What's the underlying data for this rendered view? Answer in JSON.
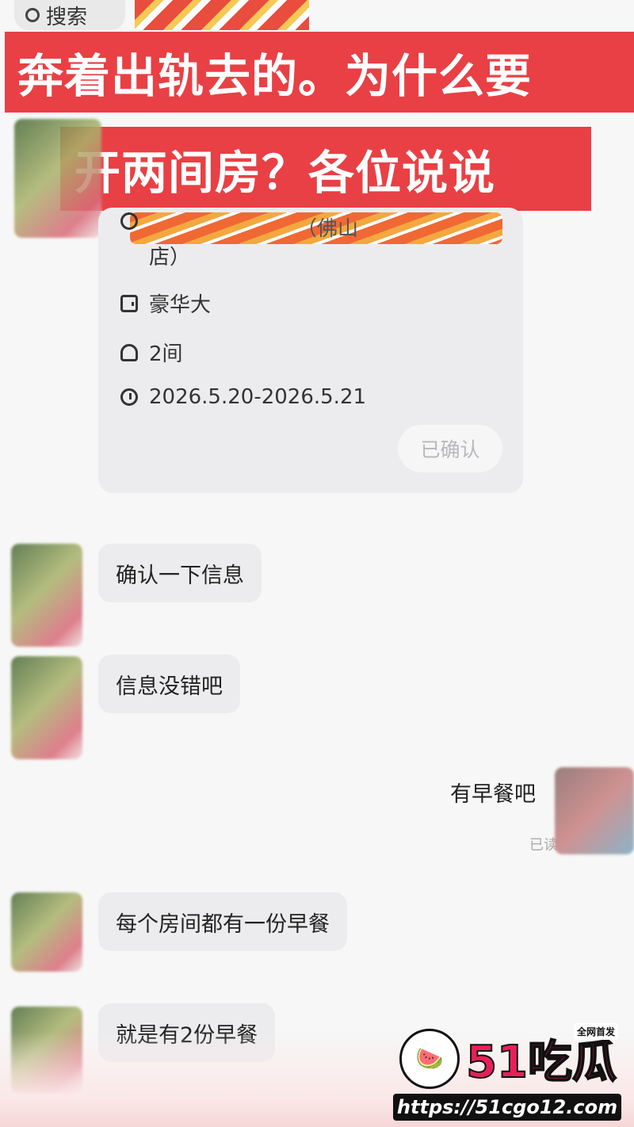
{
  "search": {
    "label": "搜索"
  },
  "overlay": {
    "line1": "奔着出轨去的。为什么要",
    "line2": "开两间房？各位说说"
  },
  "booking_card": {
    "hotel_partial": "（佛山",
    "hotel_line2": "店）",
    "room_type": "豪华大",
    "room_count": "2间",
    "dates": "2026.5.20-2026.5.21",
    "status_button": "已确认"
  },
  "messages": [
    {
      "from": "other",
      "text": "确认一下信息"
    },
    {
      "from": "other",
      "text": "信息没错吧"
    },
    {
      "from": "me",
      "text": "有早餐吧",
      "status": "已读"
    },
    {
      "from": "other",
      "text": "每个房间都有一份早餐"
    },
    {
      "from": "other",
      "text": "就是有2份早餐"
    }
  ],
  "watermark": {
    "brand": "51吃瓜",
    "badge": "全网首发",
    "url": "https://51cgo12.com"
  }
}
